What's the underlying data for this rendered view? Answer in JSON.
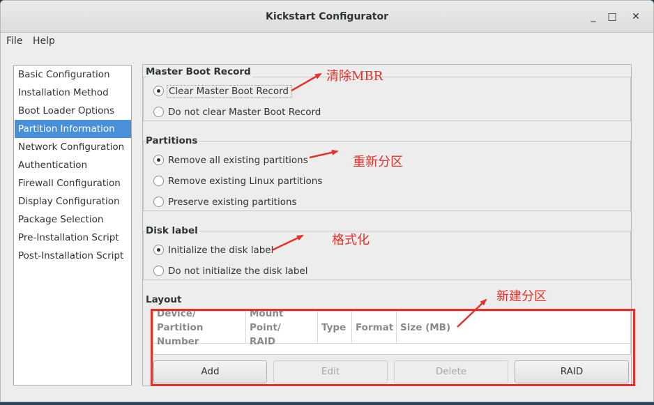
{
  "window": {
    "title": "Kickstart Configurator",
    "minimize": "_",
    "maximize": "□",
    "close": "✕"
  },
  "menubar": {
    "file": "File",
    "help": "Help"
  },
  "sidebar": {
    "items": [
      {
        "label": "Basic Configuration"
      },
      {
        "label": "Installation Method"
      },
      {
        "label": "Boot Loader Options"
      },
      {
        "label": "Partition Information"
      },
      {
        "label": "Network Configuration"
      },
      {
        "label": "Authentication"
      },
      {
        "label": "Firewall Configuration"
      },
      {
        "label": "Display Configuration"
      },
      {
        "label": "Package Selection"
      },
      {
        "label": "Pre-Installation Script"
      },
      {
        "label": "Post-Installation Script"
      }
    ],
    "selected": "Partition Information"
  },
  "mbr": {
    "label": "Master Boot Record",
    "options": [
      {
        "label": "Clear Master Boot Record",
        "checked": true
      },
      {
        "label": "Do not clear Master Boot Record",
        "checked": false
      }
    ]
  },
  "partitions": {
    "label": "Partitions",
    "options": [
      {
        "label": "Remove all existing partitions",
        "checked": true
      },
      {
        "label": "Remove existing Linux partitions",
        "checked": false
      },
      {
        "label": "Preserve existing partitions",
        "checked": false
      }
    ]
  },
  "disklabel": {
    "label": "Disk label",
    "options": [
      {
        "label": "Initialize the disk label",
        "checked": true
      },
      {
        "label": "Do not initialize the disk label",
        "checked": false
      }
    ]
  },
  "layout": {
    "label": "Layout",
    "columns": [
      {
        "line1": "Device/",
        "line2": "Partition Number"
      },
      {
        "line1": "Mount Point/",
        "line2": "RAID"
      },
      {
        "line1": "Type",
        "line2": ""
      },
      {
        "line1": "Format",
        "line2": ""
      },
      {
        "line1": "Size (MB)",
        "line2": ""
      }
    ],
    "buttons": {
      "add": "Add",
      "edit": "Edit",
      "delete": "Delete",
      "raid": "RAID"
    }
  },
  "annotations": {
    "mbr": "清除MBR",
    "partitions": "重新分区",
    "disklabel": "格式化",
    "layout": "新建分区",
    "color": "#e8302a"
  }
}
